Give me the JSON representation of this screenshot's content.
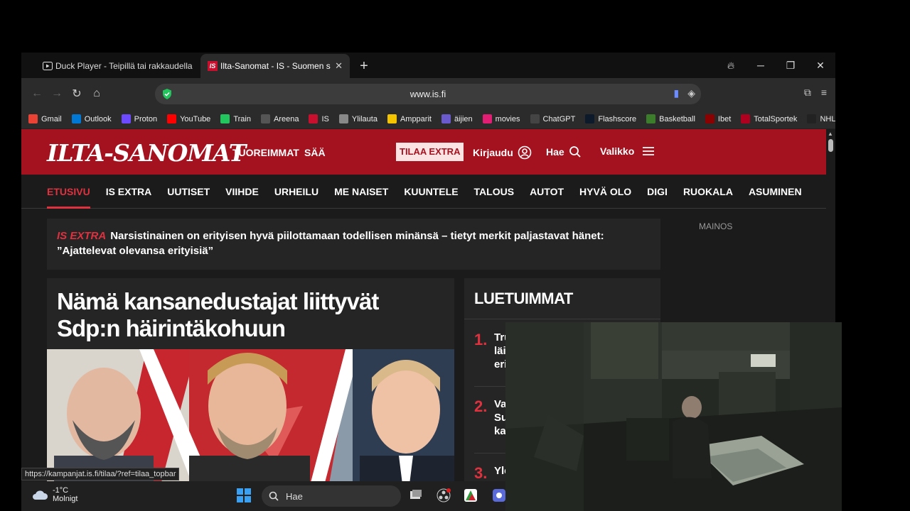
{
  "browser": {
    "tabs": [
      {
        "title": "Duck Player - Teipillä tai rakkaudella",
        "icon": "play-icon",
        "active": false
      },
      {
        "title": "Ilta-Sanomat - IS - Suomen suurin",
        "icon": "is-logo-icon",
        "active": true
      }
    ],
    "url": "www.is.fi",
    "bookmarks": [
      {
        "label": "Gmail",
        "color": "#ea4335"
      },
      {
        "label": "Outlook",
        "color": "#0078d4"
      },
      {
        "label": "Proton",
        "color": "#6d4aff"
      },
      {
        "label": "YouTube",
        "color": "#ff0000"
      },
      {
        "label": "Train",
        "color": "#22c55e"
      },
      {
        "label": "Areena",
        "color": "#555555"
      },
      {
        "label": "IS",
        "color": "#c8102e"
      },
      {
        "label": "Ylilauta",
        "color": "#888888"
      },
      {
        "label": "Ampparit",
        "color": "#f5c400"
      },
      {
        "label": "äijien",
        "color": "#6a5acd"
      },
      {
        "label": "movies",
        "color": "#e11d74"
      },
      {
        "label": "ChatGPT",
        "color": "#444444"
      },
      {
        "label": "Flashscore",
        "color": "#0c1a2b"
      },
      {
        "label": "Basketball",
        "color": "#3b7d2b"
      },
      {
        "label": "Ibet",
        "color": "#8b0000"
      },
      {
        "label": "TotalSportek",
        "color": "#b00020"
      },
      {
        "label": "NHL",
        "color": "#222222"
      }
    ],
    "status_url": "https://kampanjat.is.fi/tilaa/?ref=tilaa_topbar"
  },
  "site": {
    "logo": "ILTA-SANOMAT",
    "header_links": [
      "TUOREIMMAT",
      "SÄÄ"
    ],
    "subscribe": "TILAA EXTRA",
    "login": "Kirjaudu",
    "search": "Hae",
    "menu": "Valikko",
    "nav": [
      "ETUSIVU",
      "IS EXTRA",
      "UUTISET",
      "VIIHDE",
      "URHEILU",
      "ME NAISET",
      "KUUNTELE",
      "TALOUS",
      "AUTOT",
      "HYVÄ OLO",
      "DIGI",
      "RUOKALA",
      "ASUMINEN"
    ],
    "active_nav": "ETUSIVU",
    "isextra": {
      "tag": "IS EXTRA",
      "text": "Narsistinainen on erityisen hyvä piilottamaan todellisen minänsä – tietyt merkit paljastavat hänet: ”Ajattelevat olevansa erityisiä”"
    },
    "ad_label": "MAINOS",
    "lead_title": "Nämä kansanedustajat liittyvät Sdp:n häirintäkohuun",
    "luetuimmat": {
      "heading": "LUETUIMMAT",
      "items": [
        {
          "num": "1.",
          "text": "Tru\nläi\neri"
        },
        {
          "num": "2.",
          "text": "Va\nSu\nka"
        },
        {
          "num": "3.",
          "text": "Yle"
        }
      ]
    }
  },
  "taskbar": {
    "temperature": "-1°C",
    "weather": "Molnigt",
    "search_placeholder": "Hae"
  }
}
